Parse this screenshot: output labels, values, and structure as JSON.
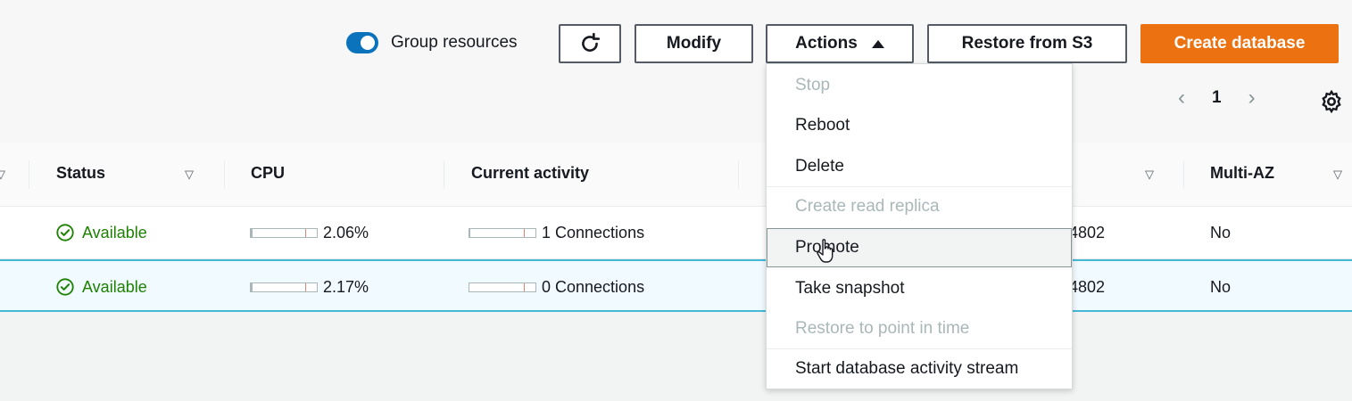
{
  "toolbar": {
    "group_resources_label": "Group resources",
    "refresh_icon": "refresh-icon",
    "modify_label": "Modify",
    "actions_label": "Actions",
    "restore_label": "Restore from S3",
    "create_label": "Create database"
  },
  "pagination": {
    "page": "1"
  },
  "columns": {
    "status": "Status",
    "cpu": "CPU",
    "activity": "Current activity",
    "multiaz": "Multi-AZ"
  },
  "rows": [
    {
      "status": "Available",
      "cpu": "2.06%",
      "cpu_fraction": 0.0206,
      "activity": "1 Connections",
      "port_fragment": "4802",
      "multiaz": "No"
    },
    {
      "status": "Available",
      "cpu": "2.17%",
      "cpu_fraction": 0.0217,
      "activity": "0 Connections",
      "port_fragment": "4802",
      "multiaz": "No"
    }
  ],
  "actions_menu": {
    "items": [
      {
        "label": "Stop",
        "enabled": false
      },
      {
        "label": "Reboot",
        "enabled": true
      },
      {
        "label": "Delete",
        "enabled": true
      },
      {
        "label": "Create read replica",
        "enabled": false
      },
      {
        "label": "Promote",
        "enabled": true,
        "hovered": true
      },
      {
        "label": "Take snapshot",
        "enabled": true
      },
      {
        "label": "Restore to point in time",
        "enabled": false
      },
      {
        "label": "Start database activity stream",
        "enabled": true
      }
    ]
  },
  "colors": {
    "accent": "#ec7211",
    "toggle": "#0a73bb",
    "status_ok": "#1d8102",
    "selected_row": "#f1faff"
  }
}
